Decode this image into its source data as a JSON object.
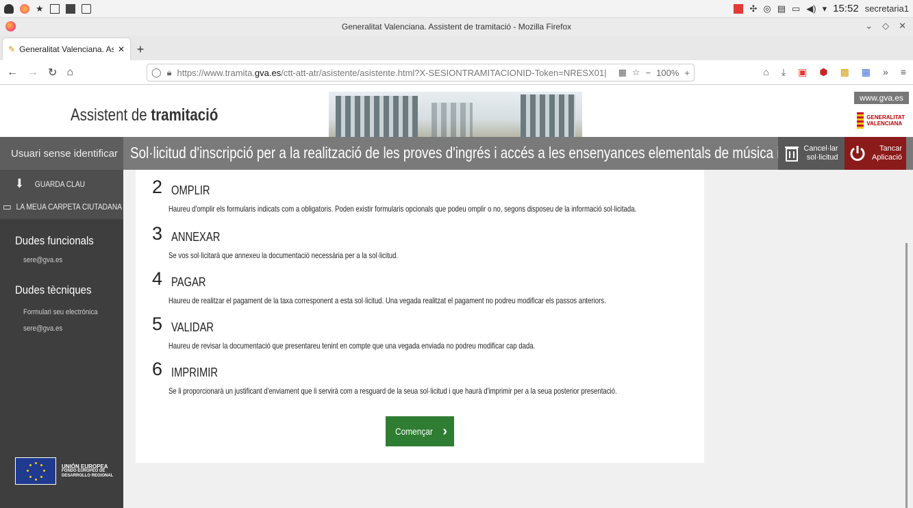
{
  "os": {
    "clock": "15:52",
    "user": "secretaria1"
  },
  "browser": {
    "window_title": "Generalitat Valenciana. Assistent de tramitació - Mozilla Firefox",
    "tab_title": "Generalitat Valenciana. Ass",
    "url_prefix": "https://www.tramita.",
    "url_domain": "gva.es",
    "url_rest": "/ctt-att-atr/asistente/asistente.html?X-SESIONTRAMITACIONID-Token=NRESX01|",
    "zoom": "100%"
  },
  "header": {
    "title_plain": "Assistent de ",
    "title_bold": "tramitació",
    "gva_link": "www.gva.es",
    "logo_line1": "GENERALITAT",
    "logo_line2": "VALENCIANA"
  },
  "bar": {
    "user": "Usuari sense identificar",
    "procedure_title": "Sol·licitud d'inscripció per a la realització de les proves d'ingrés i accés a les ensenyances elementals de música i dansa",
    "cancel_line1": "Cancel·lar",
    "cancel_line2": "sol·licitud",
    "close_line1": "Tancar",
    "close_line2": "Aplicació"
  },
  "sidebar": {
    "save_key": "GUARDA CLAU",
    "folder": "LA MEUA CARPETA CIUTADANA",
    "functional_heading": "Dudes funcionals",
    "functional_email": "sere@gva.es",
    "technical_heading": "Dudes tècniques",
    "technical_form": "Formulari seu electrònica",
    "technical_email": "sere@gva.es",
    "eu_line1": "UNIÓN EUROPEA",
    "eu_line2": "FONDO EUROPEO DE",
    "eu_line3": "DESARROLLO REGIONAL"
  },
  "steps": [
    {
      "num": "2",
      "name": "OMPLIR",
      "desc": "Haureu d'omplir els formularis indicats com a obligatoris. Poden existir formularis opcionals que podeu omplir o no, segons disposeu de la informació sol·licitada."
    },
    {
      "num": "3",
      "name": "ANNEXAR",
      "desc": "Se vos sol·licitarà que annexeu la documentació necessària per a la sol·licitud."
    },
    {
      "num": "4",
      "name": "PAGAR",
      "desc": "Haureu de realitzar el pagament de la taxa corresponent a esta sol·licitud. Una vegada realitzat el pagament no podreu modificar els passos anteriors."
    },
    {
      "num": "5",
      "name": "VALIDAR",
      "desc": "Haureu de revisar la documentació que presentareu tenint en compte que una vegada enviada no podreu modificar cap dada."
    },
    {
      "num": "6",
      "name": "IMPRIMIR",
      "desc": "Se li proporcionarà un justificant d'enviament que li servirà com a resguard de la seua sol·licitud i que haurà d'imprimir per a la seua posterior presentació."
    }
  ],
  "start_label": "Començar",
  "colors": {
    "start_green": "#2e7d32",
    "close_red": "#8b1a1a",
    "bar_gray": "#7a7a7a",
    "sidebar_dark": "#3e3e3e"
  }
}
